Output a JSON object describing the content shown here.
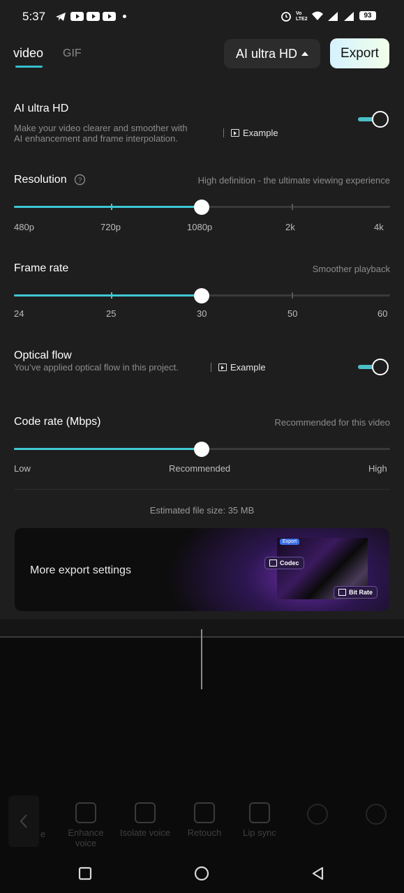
{
  "status_bar": {
    "time": "5:37",
    "battery": "93",
    "icons": [
      "telegram-icon",
      "youtube-icon",
      "youtube-icon",
      "youtube-icon",
      "dot-icon",
      "alarm-icon",
      "volte-icon",
      "wifi-icon",
      "signal-icon",
      "signal-icon",
      "battery-icon"
    ]
  },
  "tabs": [
    {
      "label": "video",
      "active": true
    },
    {
      "label": "GIF",
      "active": false
    }
  ],
  "quality_selector": {
    "label": "AI ultra HD"
  },
  "export_button": {
    "label": "Export"
  },
  "ai_ultra_hd": {
    "title": "AI ultra HD",
    "description_line1": "Make your video clearer and smoother with",
    "description_line2": "AI enhancement and frame interpolation.",
    "example_label": "Example",
    "enabled": true
  },
  "resolution": {
    "title": "Resolution",
    "hint": "High definition - the ultimate viewing experience",
    "options": [
      "480p",
      "720p",
      "1080p",
      "2k",
      "4k"
    ],
    "selected": "1080p"
  },
  "frame_rate": {
    "title": "Frame rate",
    "hint": "Smoother playback",
    "options": [
      "24",
      "25",
      "30",
      "50",
      "60"
    ],
    "selected": "30"
  },
  "optical_flow": {
    "title": "Optical flow",
    "description": "You’ve applied optical flow in this project.",
    "example_label": "Example",
    "enabled": true
  },
  "code_rate": {
    "title": "Code rate (Mbps)",
    "hint": "Recommended for this video",
    "options": [
      "Low",
      "Recommended",
      "High"
    ],
    "selected": "Recommended"
  },
  "file_size": "Estimated file size: 35 MB",
  "more_settings": {
    "label": "More export settings",
    "thumb_export": "Export",
    "chip_codec": "Codec",
    "chip_bitrate": "Bit Rate"
  },
  "toolbar": [
    {
      "label": "e",
      "icon": "back-arrow-icon"
    },
    {
      "label": "Enhance voice",
      "icon": "enhance-voice-icon"
    },
    {
      "label": "Isolate voice",
      "icon": "isolate-voice-icon"
    },
    {
      "label": "Retouch",
      "icon": "retouch-icon"
    },
    {
      "label": "Lip sync",
      "icon": "lip-sync-icon"
    }
  ],
  "nav": [
    "recents-icon",
    "home-icon",
    "back-icon"
  ],
  "colors": {
    "accent": "#3ec8d4",
    "background": "#1e1e1e"
  }
}
